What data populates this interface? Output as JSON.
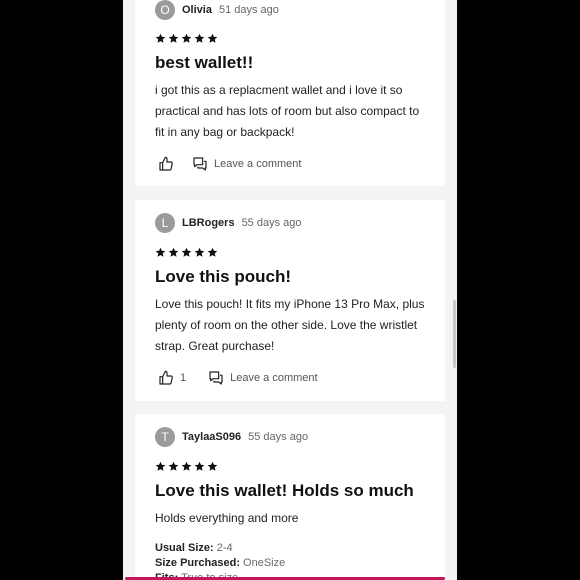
{
  "reviews": [
    {
      "avatar_letter": "O",
      "author": "Olivia",
      "date": "51 days ago",
      "rating": 5,
      "title": "best wallet!!",
      "body": "i got this as a replacment wallet and i love it so practical and has lots of room but also compact to fit in any bag or backpack!",
      "likes": "",
      "comment_label": "Leave a comment"
    },
    {
      "avatar_letter": "L",
      "author": "LBRogers",
      "date": "55 days ago",
      "rating": 5,
      "title": "Love this pouch!",
      "body": "Love this pouch! It fits my iPhone 13 Pro Max, plus plenty of room on the other side. Love the wristlet strap. Great purchase!",
      "likes": "1",
      "comment_label": "Leave a comment"
    },
    {
      "avatar_letter": "T",
      "author": "TaylaaS096",
      "date": "55 days ago",
      "rating": 5,
      "title": "Love this wallet! Holds so much",
      "body": "Holds everything and more",
      "specs": [
        {
          "label": "Usual Size:",
          "value": "2-4"
        },
        {
          "label": "Size Purchased:",
          "value": "OneSize"
        },
        {
          "label": "Fits:",
          "value": "True to size"
        }
      ]
    }
  ],
  "colors": {
    "page_bg": "#000000",
    "feed_bg": "#f3f3f3",
    "avatar_bg": "#9b9b9b",
    "accent_bar": "#c2185b"
  }
}
